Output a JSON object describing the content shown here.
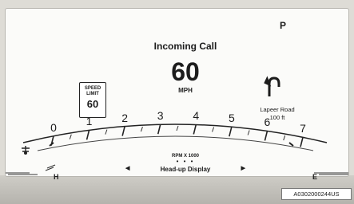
{
  "hud": {
    "gear": "P",
    "incoming_call": "Incoming Call",
    "speed": {
      "value": "60",
      "unit": "MPH"
    },
    "speed_limit": {
      "label_line1": "SPEED",
      "label_line2": "LIMIT",
      "value": "60"
    },
    "navigation": {
      "turn_icon": "u-turn-left-icon",
      "street": "Lapeer Road",
      "distance": "100 ft"
    },
    "tachometer": {
      "tick_labels": [
        "0",
        "1",
        "2",
        "3",
        "4",
        "5",
        "6",
        "7"
      ],
      "unit_label": "RPM X 1000",
      "icon": "temperature-icon"
    },
    "temperature_gauge_label": "H",
    "fuel_gauge_label": "E",
    "display_selector": {
      "prev_icon": "left-arrow-icon",
      "label": "Head-up Display",
      "next_icon": "right-arrow-icon",
      "page_dots": "• • •"
    }
  },
  "figure_id": "A0302000244US",
  "colors": {
    "screen": "#fbfbf9",
    "ink": "#1c1c1c",
    "bezel": "#dedcd6"
  }
}
